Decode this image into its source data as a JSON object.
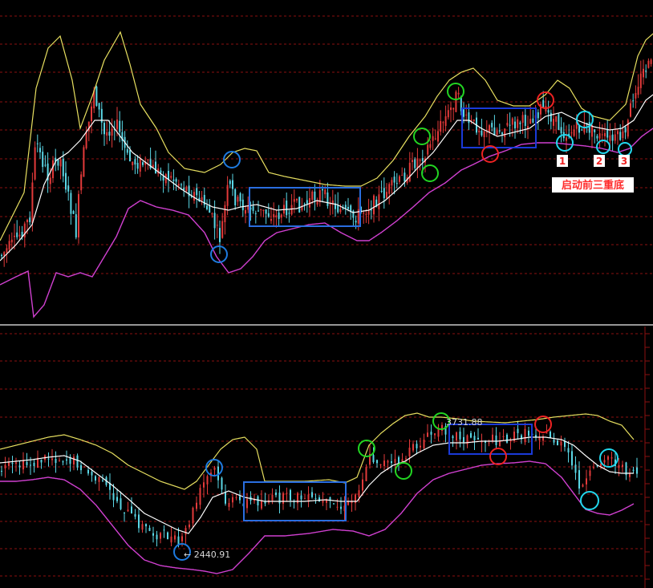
{
  "colors": {
    "background": "#000000",
    "grid": "#8b1010",
    "separator": "#c8c8c8",
    "candle_up": "#e23a3a",
    "candle_down": "#5ad7e6",
    "band_upper": "#e8e060",
    "band_middle": "#ffffff",
    "band_lower": "#d040d0",
    "circle_blue": "#1e7be0",
    "circle_green": "#22d622",
    "circle_red": "#ee2222",
    "circle_cyan": "#22d8ee",
    "box_blue": "#2a6ee0",
    "box_navy": "#1a3ad8",
    "label_red": "#ff2a2a"
  },
  "chart_data": [
    {
      "type": "candlestick",
      "panel": "top",
      "indicator": "bollinger-bands",
      "title": "",
      "xlabel": "",
      "ylabel": "",
      "grid": true,
      "annotations": {
        "numbers": [
          "1",
          "2",
          "3"
        ],
        "label": "启动前三重底"
      }
    },
    {
      "type": "candlestick",
      "panel": "bottom",
      "indicator": "bollinger-bands",
      "title": "",
      "xlabel": "",
      "ylabel": "",
      "grid": true,
      "annotations": {
        "high_price_label": "3731.88",
        "low_price_label": "← 2440.91"
      }
    }
  ]
}
